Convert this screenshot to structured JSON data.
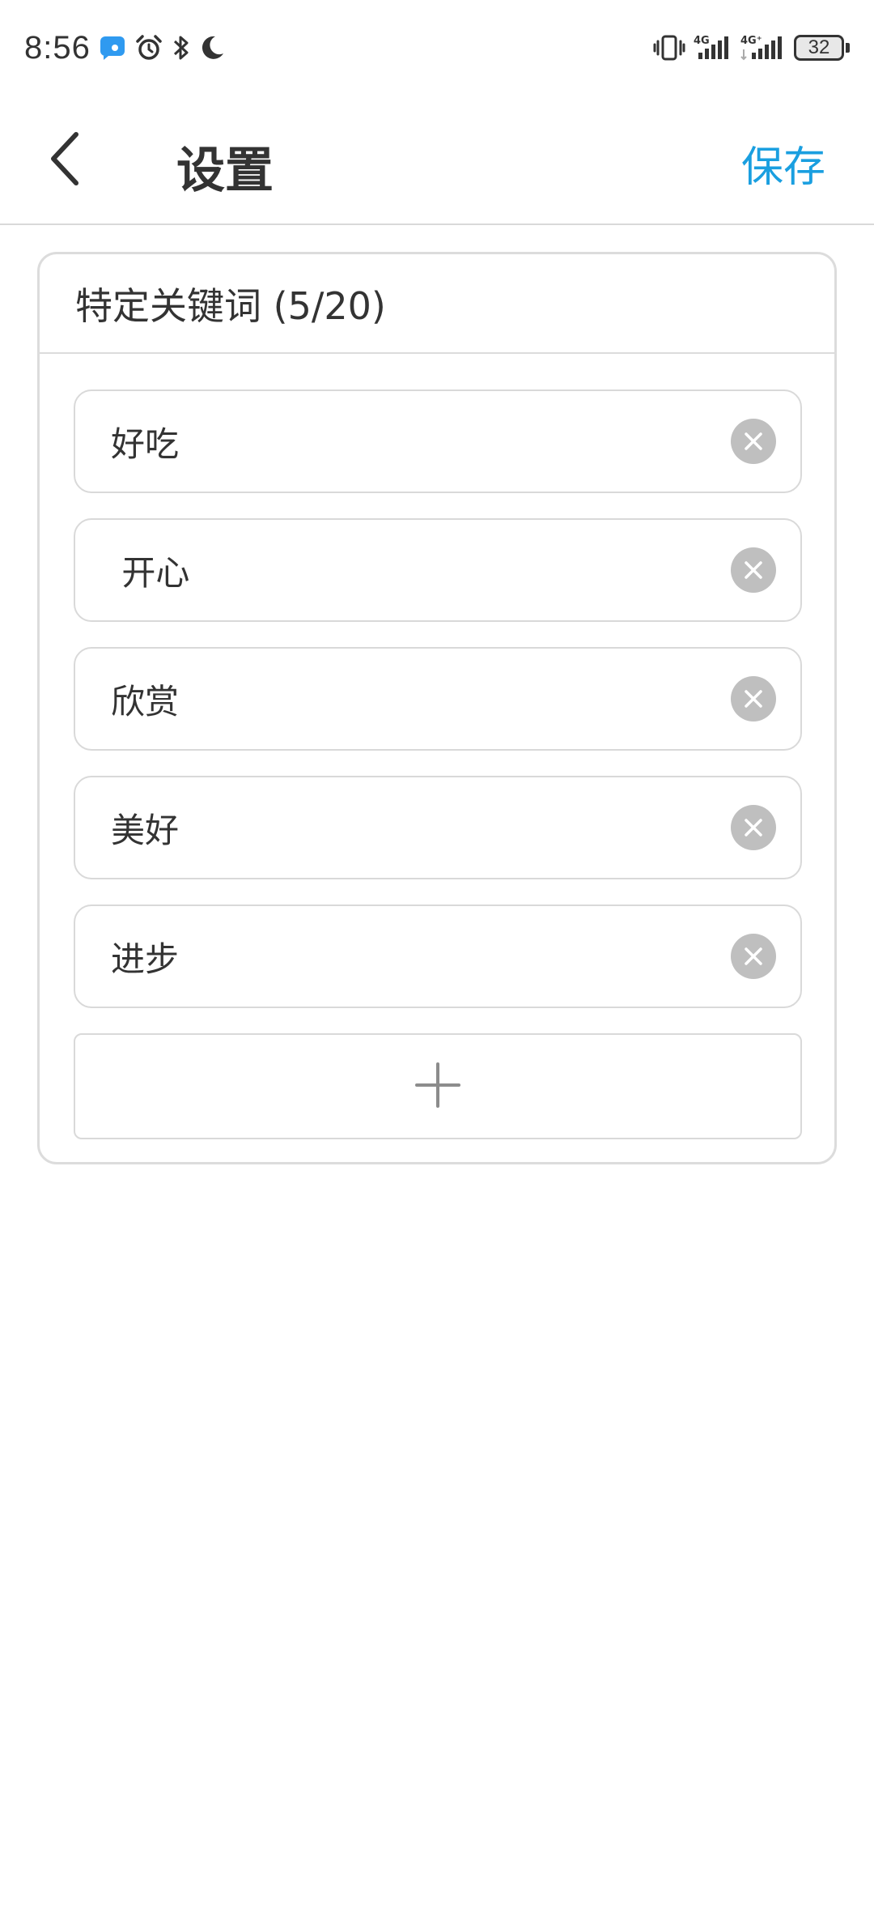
{
  "status_bar": {
    "time": "8:56",
    "battery_level": "32",
    "left_icons": [
      "chat-notification-icon",
      "alarm-icon",
      "bluetooth-icon",
      "moon-icon"
    ],
    "right_icons": [
      "vibrate-icon",
      "signal-4g-icon",
      "signal-4g-plus-icon",
      "battery-icon"
    ],
    "network_label_1": "4G",
    "network_label_2": "4G⁺"
  },
  "header": {
    "back_icon": "chevron-left-icon",
    "title": "设置",
    "save_label": "保存",
    "save_color": "#1a9fe0"
  },
  "keywords_card": {
    "title": "特定关键词 (5/20)",
    "items": [
      {
        "text": "好吃"
      },
      {
        "text": " 开心"
      },
      {
        "text": "欣赏"
      },
      {
        "text": "美好"
      },
      {
        "text": "进步"
      }
    ],
    "remove_icon": "close-circle-icon",
    "add_icon": "plus-icon"
  }
}
